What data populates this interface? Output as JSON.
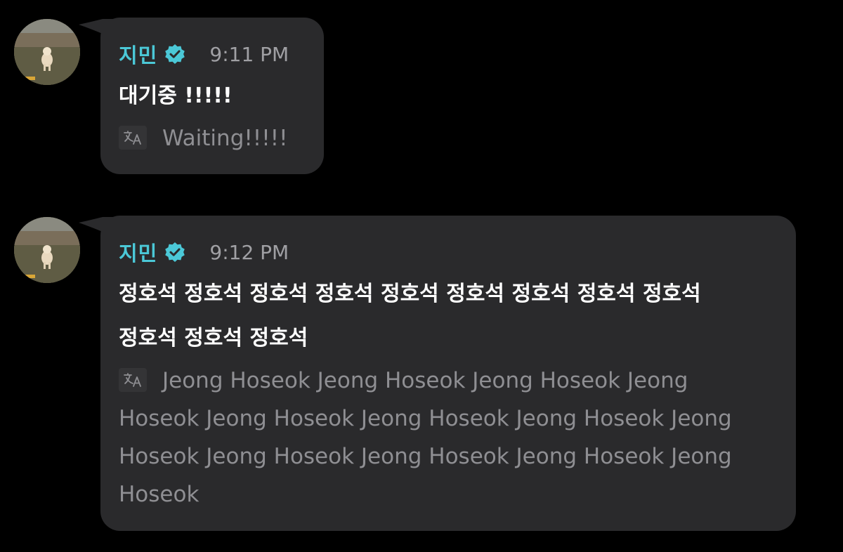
{
  "messages": [
    {
      "sender": "지민",
      "time": "9:11 PM",
      "text": "대기중 !!!!!",
      "translation": "Waiting!!!!!"
    },
    {
      "sender": "지민",
      "time": "9:12 PM",
      "text": "정호석 정호석 정호석 정호석 정호석 정호석 정호석 정호석 정호석 정호석 정호석 정호석",
      "translation": "Jeong Hoseok Jeong Hoseok Jeong Hoseok Jeong Hoseok Jeong Hoseok Jeong Hoseok Jeong Hoseok Jeong Hoseok Jeong Hoseok Jeong Hoseok Jeong Hoseok Jeong Hoseok"
    }
  ],
  "icons": {
    "verified": "verified-badge-icon",
    "translate": "translate-icon"
  },
  "colors": {
    "background": "#000000",
    "bubble": "#2a2a2c",
    "sender": "#4bc8d7",
    "text": "#ffffff",
    "translation": "#8f8f93",
    "time": "#a0a0a4"
  }
}
